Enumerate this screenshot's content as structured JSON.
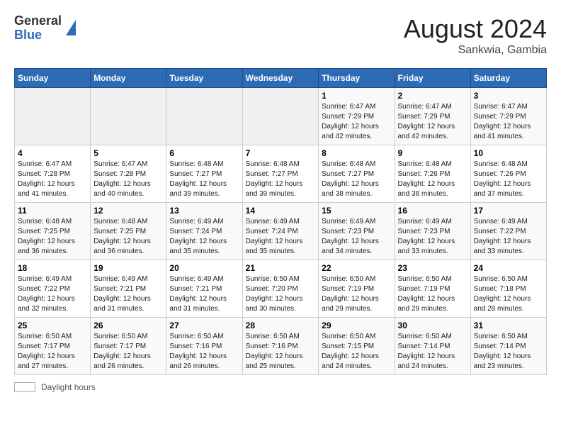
{
  "header": {
    "logo_line1": "General",
    "logo_line2": "Blue",
    "title": "August 2024",
    "subtitle": "Sankwia, Gambia"
  },
  "days_of_week": [
    "Sunday",
    "Monday",
    "Tuesday",
    "Wednesday",
    "Thursday",
    "Friday",
    "Saturday"
  ],
  "weeks": [
    [
      {
        "day": "",
        "info": ""
      },
      {
        "day": "",
        "info": ""
      },
      {
        "day": "",
        "info": ""
      },
      {
        "day": "",
        "info": ""
      },
      {
        "day": "1",
        "info": "Sunrise: 6:47 AM\nSunset: 7:29 PM\nDaylight: 12 hours and 42 minutes."
      },
      {
        "day": "2",
        "info": "Sunrise: 6:47 AM\nSunset: 7:29 PM\nDaylight: 12 hours and 42 minutes."
      },
      {
        "day": "3",
        "info": "Sunrise: 6:47 AM\nSunset: 7:29 PM\nDaylight: 12 hours and 41 minutes."
      }
    ],
    [
      {
        "day": "4",
        "info": "Sunrise: 6:47 AM\nSunset: 7:28 PM\nDaylight: 12 hours and 41 minutes."
      },
      {
        "day": "5",
        "info": "Sunrise: 6:47 AM\nSunset: 7:28 PM\nDaylight: 12 hours and 40 minutes."
      },
      {
        "day": "6",
        "info": "Sunrise: 6:48 AM\nSunset: 7:27 PM\nDaylight: 12 hours and 39 minutes."
      },
      {
        "day": "7",
        "info": "Sunrise: 6:48 AM\nSunset: 7:27 PM\nDaylight: 12 hours and 39 minutes."
      },
      {
        "day": "8",
        "info": "Sunrise: 6:48 AM\nSunset: 7:27 PM\nDaylight: 12 hours and 38 minutes."
      },
      {
        "day": "9",
        "info": "Sunrise: 6:48 AM\nSunset: 7:26 PM\nDaylight: 12 hours and 38 minutes."
      },
      {
        "day": "10",
        "info": "Sunrise: 6:48 AM\nSunset: 7:26 PM\nDaylight: 12 hours and 37 minutes."
      }
    ],
    [
      {
        "day": "11",
        "info": "Sunrise: 6:48 AM\nSunset: 7:25 PM\nDaylight: 12 hours and 36 minutes."
      },
      {
        "day": "12",
        "info": "Sunrise: 6:48 AM\nSunset: 7:25 PM\nDaylight: 12 hours and 36 minutes."
      },
      {
        "day": "13",
        "info": "Sunrise: 6:49 AM\nSunset: 7:24 PM\nDaylight: 12 hours and 35 minutes."
      },
      {
        "day": "14",
        "info": "Sunrise: 6:49 AM\nSunset: 7:24 PM\nDaylight: 12 hours and 35 minutes."
      },
      {
        "day": "15",
        "info": "Sunrise: 6:49 AM\nSunset: 7:23 PM\nDaylight: 12 hours and 34 minutes."
      },
      {
        "day": "16",
        "info": "Sunrise: 6:49 AM\nSunset: 7:23 PM\nDaylight: 12 hours and 33 minutes."
      },
      {
        "day": "17",
        "info": "Sunrise: 6:49 AM\nSunset: 7:22 PM\nDaylight: 12 hours and 33 minutes."
      }
    ],
    [
      {
        "day": "18",
        "info": "Sunrise: 6:49 AM\nSunset: 7:22 PM\nDaylight: 12 hours and 32 minutes."
      },
      {
        "day": "19",
        "info": "Sunrise: 6:49 AM\nSunset: 7:21 PM\nDaylight: 12 hours and 31 minutes."
      },
      {
        "day": "20",
        "info": "Sunrise: 6:49 AM\nSunset: 7:21 PM\nDaylight: 12 hours and 31 minutes."
      },
      {
        "day": "21",
        "info": "Sunrise: 6:50 AM\nSunset: 7:20 PM\nDaylight: 12 hours and 30 minutes."
      },
      {
        "day": "22",
        "info": "Sunrise: 6:50 AM\nSunset: 7:19 PM\nDaylight: 12 hours and 29 minutes."
      },
      {
        "day": "23",
        "info": "Sunrise: 6:50 AM\nSunset: 7:19 PM\nDaylight: 12 hours and 29 minutes."
      },
      {
        "day": "24",
        "info": "Sunrise: 6:50 AM\nSunset: 7:18 PM\nDaylight: 12 hours and 28 minutes."
      }
    ],
    [
      {
        "day": "25",
        "info": "Sunrise: 6:50 AM\nSunset: 7:17 PM\nDaylight: 12 hours and 27 minutes."
      },
      {
        "day": "26",
        "info": "Sunrise: 6:50 AM\nSunset: 7:17 PM\nDaylight: 12 hours and 26 minutes."
      },
      {
        "day": "27",
        "info": "Sunrise: 6:50 AM\nSunset: 7:16 PM\nDaylight: 12 hours and 26 minutes."
      },
      {
        "day": "28",
        "info": "Sunrise: 6:50 AM\nSunset: 7:16 PM\nDaylight: 12 hours and 25 minutes."
      },
      {
        "day": "29",
        "info": "Sunrise: 6:50 AM\nSunset: 7:15 PM\nDaylight: 12 hours and 24 minutes."
      },
      {
        "day": "30",
        "info": "Sunrise: 6:50 AM\nSunset: 7:14 PM\nDaylight: 12 hours and 24 minutes."
      },
      {
        "day": "31",
        "info": "Sunrise: 6:50 AM\nSunset: 7:14 PM\nDaylight: 12 hours and 23 minutes."
      }
    ]
  ],
  "footer": {
    "label": "Daylight hours"
  }
}
